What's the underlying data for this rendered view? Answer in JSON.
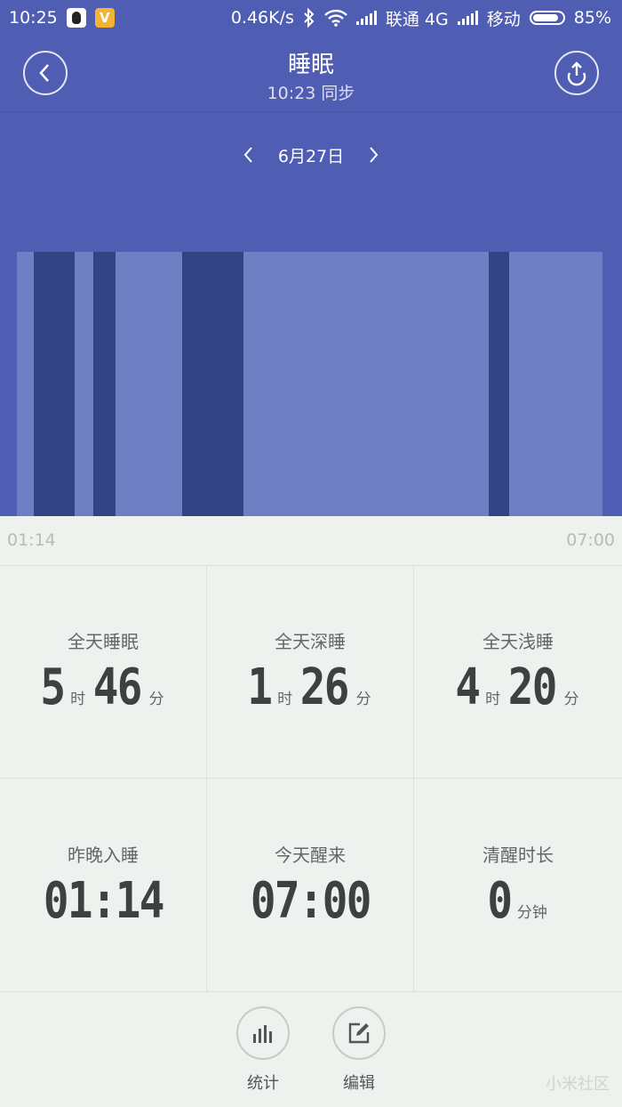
{
  "status_bar": {
    "time": "10:25",
    "speed": "0.46K/s",
    "carrier1": "联通 4G",
    "carrier2": "移动",
    "battery": "85%",
    "icons": [
      "qq-icon",
      "v-app-icon",
      "bluetooth-icon",
      "wifi-icon",
      "signal-icon",
      "battery-icon"
    ]
  },
  "header": {
    "title": "睡眠",
    "subtitle": "10:23 同步",
    "back_icon": "chevron-left-icon",
    "share_icon": "upload-icon"
  },
  "date_nav": {
    "date": "6月27日"
  },
  "sleep_chart": {
    "start_label": "01:14",
    "end_label": "07:00",
    "colors": {
      "deep": "#334283",
      "light": "#6f7dc2",
      "background": "#4f5db2"
    },
    "stages": [
      {
        "stage": "light",
        "from": "01:14",
        "to": "01:24"
      },
      {
        "stage": "deep",
        "from": "01:24",
        "to": "01:48"
      },
      {
        "stage": "light",
        "from": "01:48",
        "to": "01:59"
      },
      {
        "stage": "deep",
        "from": "01:59",
        "to": "02:12"
      },
      {
        "stage": "light",
        "from": "02:12",
        "to": "02:51"
      },
      {
        "stage": "deep",
        "from": "02:51",
        "to": "03:27"
      },
      {
        "stage": "light",
        "from": "03:27",
        "to": "05:51"
      },
      {
        "stage": "deep",
        "from": "05:51",
        "to": "06:03"
      },
      {
        "stage": "light",
        "from": "06:03",
        "to": "06:58"
      }
    ]
  },
  "stats": [
    {
      "label": "全天睡眠",
      "parts": [
        {
          "n": "5",
          "u": "时"
        },
        {
          "n": "46",
          "u": "分"
        }
      ]
    },
    {
      "label": "全天深睡",
      "parts": [
        {
          "n": "1",
          "u": "时"
        },
        {
          "n": "26",
          "u": "分"
        }
      ]
    },
    {
      "label": "全天浅睡",
      "parts": [
        {
          "n": "4",
          "u": "时"
        },
        {
          "n": "20",
          "u": "分"
        }
      ]
    },
    {
      "label": "昨晚入睡",
      "parts": [
        {
          "n": "01:14",
          "u": ""
        }
      ]
    },
    {
      "label": "今天醒来",
      "parts": [
        {
          "n": "07:00",
          "u": ""
        }
      ]
    },
    {
      "label": "清醒时长",
      "parts": [
        {
          "n": "0",
          "u": "分钟"
        }
      ]
    }
  ],
  "actions": [
    {
      "label": "统计",
      "icon": "bar-chart-icon"
    },
    {
      "label": "编辑",
      "icon": "edit-icon"
    }
  ],
  "watermark": "小米社区"
}
